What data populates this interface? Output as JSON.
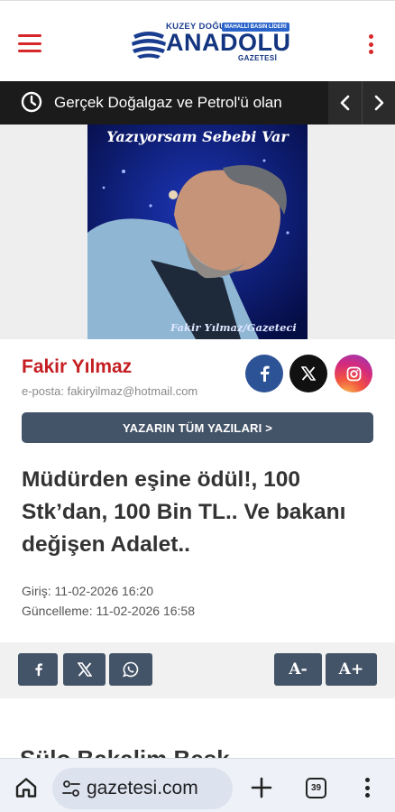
{
  "header": {
    "menu_icon": "hamburger-icon",
    "logo": {
      "top_text": "KUZEY DOĞU",
      "badge": "MAHALLİ BASIN LİDERİ",
      "main_text": "ANADOLU",
      "sub_text": "GAZETESİ"
    },
    "more_icon": "vertical-dots-icon",
    "accent_color": "#d6272b"
  },
  "ticker": {
    "icon": "clock-icon",
    "text": "Gerçek Doğalgaz ve Petrol'ü olan",
    "prev_icon": "chevron-left-icon",
    "next_icon": "chevron-right-icon"
  },
  "author_photo": {
    "caption_top": "Yazıyorsam Sebebi Var",
    "caption_bottom": "Fakir Yılmaz/Gazeteci"
  },
  "author": {
    "name": "Fakir Yılmaz",
    "email": "e-posta: fakiryilmaz@hotmail.com",
    "name_color": "#c41e22",
    "social": [
      "facebook-icon",
      "x-icon",
      "instagram-icon"
    ],
    "all_posts_label": "YAZARIN TÜM YAZILARI >"
  },
  "article": {
    "title": "Müdürden eşine ödül!, 100 Stk’dan, 100 Bin TL.. Ve bakanı değişen Adalet..",
    "created": "Giriş: 11-02-2026 16:20",
    "updated": "Güncelleme: 11-02-2026 16:58",
    "next_heading": "Sülo Bakalim Beşk..."
  },
  "share_bar": {
    "buttons": [
      "facebook-icon",
      "x-icon",
      "whatsapp-icon"
    ],
    "font_down_label": "A-",
    "font_up_label": "A+",
    "button_color": "#445468"
  },
  "browser": {
    "url": "gazetesi.com",
    "tab_count": "39",
    "icons": [
      "home-icon",
      "site-settings-icon",
      "plus-icon",
      "tabs-icon",
      "menu-icon"
    ]
  }
}
